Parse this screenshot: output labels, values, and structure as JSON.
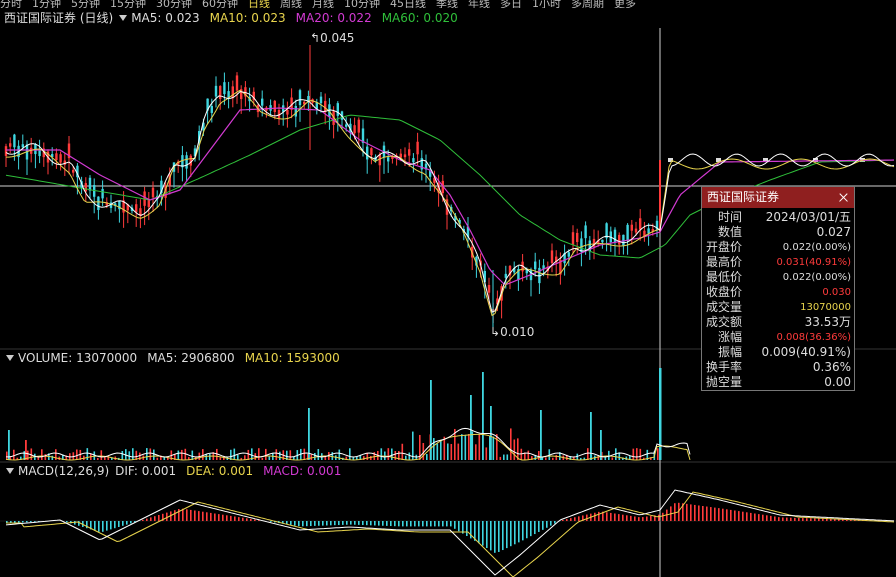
{
  "topbar": {
    "items": [
      "分时",
      "1分钟",
      "5分钟",
      "15分钟",
      "30分钟",
      "60分钟",
      "日线",
      "周线",
      "月线",
      "10分钟",
      "45日线",
      "季线",
      "年线",
      "多日",
      "1小时",
      "多周期",
      "更多"
    ],
    "active_index": 6
  },
  "kline": {
    "title": "西证国际证券 (日线)",
    "ma5": "MA5: 0.023",
    "ma10": "MA10: 0.023",
    "ma20": "MA20: 0.022",
    "ma60": "MA60: 0.020",
    "high_label": "0.045",
    "low_label": "0.010"
  },
  "volume": {
    "label": "VOLUME: 13070000",
    "ma5": "MA5: 2906800",
    "ma10": "MA10: 1593000"
  },
  "macd": {
    "label": "MACD(12,26,9)",
    "dif": "DIF: 0.001",
    "dea": "DEA: 0.001",
    "macd": "MACD: 0.001"
  },
  "panel": {
    "title": "西证国际证券",
    "rows": [
      {
        "k": "时间",
        "v": "2024/03/01/五",
        "c": "w"
      },
      {
        "k": "数值",
        "v": "0.027",
        "c": "w"
      },
      {
        "k": "开盘价",
        "v": "0.022(0.00%)",
        "c": "w",
        "s": true
      },
      {
        "k": "最高价",
        "v": "0.031(40.91%)",
        "c": "r",
        "s": true
      },
      {
        "k": "最低价",
        "v": "0.022(0.00%)",
        "c": "w",
        "s": true
      },
      {
        "k": "收盘价",
        "v": "0.030",
        "c": "r",
        "s": true
      },
      {
        "k": "成交量",
        "v": "13070000",
        "c": "y",
        "s": true
      },
      {
        "k": "成交额",
        "v": "33.53万",
        "c": "w"
      },
      {
        "k": "涨幅",
        "v": "0.008(36.36%)",
        "c": "r",
        "s": true
      },
      {
        "k": "振幅",
        "v": "0.009(40.91%)",
        "c": "w"
      },
      {
        "k": "换手率",
        "v": "0.36%",
        "c": "w"
      },
      {
        "k": "抛空量",
        "v": "0.00",
        "c": "w"
      }
    ]
  },
  "colors": {
    "up": "#ff3b3b",
    "down": "#3fd6e0",
    "ma5": "#ffffff",
    "ma10": "#e8d44d",
    "ma20": "#d23ad2",
    "ma60": "#2fbf3a",
    "bg": "#000000"
  }
}
